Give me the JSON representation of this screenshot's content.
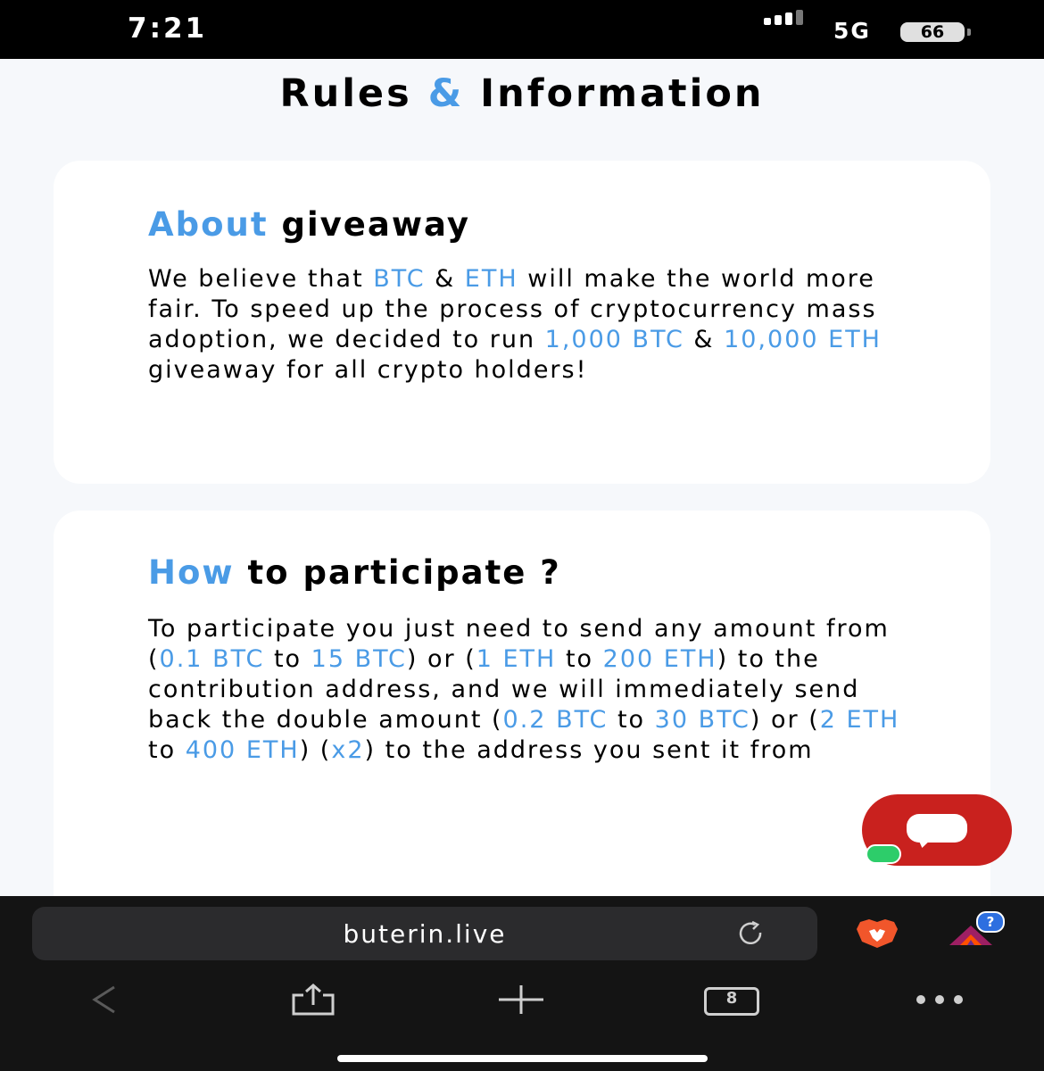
{
  "status_bar": {
    "time": "7:21",
    "network": "5G",
    "battery": "66"
  },
  "page": {
    "title_part1": "Rules",
    "title_amp": "&",
    "title_part2": "Information"
  },
  "about_card": {
    "title_accent": "About",
    "title_rest": "giveaway",
    "body": [
      {
        "t": "We believe that ",
        "hl": false
      },
      {
        "t": "BTC",
        "hl": true
      },
      {
        "t": " & ",
        "hl": false
      },
      {
        "t": "ETH",
        "hl": true
      },
      {
        "t": " will make the world more fair. To speed up the process of cryptocurrency mass adoption, we decided to run ",
        "hl": false
      },
      {
        "t": "1,000 BTC",
        "hl": true
      },
      {
        "t": " & ",
        "hl": false
      },
      {
        "t": "10,000 ETH",
        "hl": true
      },
      {
        "t": " giveaway for all crypto holders!",
        "hl": false
      }
    ]
  },
  "how_card": {
    "title_accent": "How",
    "title_rest": "to participate ?",
    "body": [
      {
        "t": "To participate you just need to send any amount from (",
        "hl": false
      },
      {
        "t": "0.1 BTC",
        "hl": true
      },
      {
        "t": " to ",
        "hl": false
      },
      {
        "t": "15 BTC",
        "hl": true
      },
      {
        "t": ") or (",
        "hl": false
      },
      {
        "t": "1 ETH",
        "hl": true
      },
      {
        "t": " to ",
        "hl": false
      },
      {
        "t": "200 ETH",
        "hl": true
      },
      {
        "t": ") to the contribution address, and we will immediately send back the double amount (",
        "hl": false
      },
      {
        "t": "0.2 BTC",
        "hl": true
      },
      {
        "t": " to ",
        "hl": false
      },
      {
        "t": "30 BTC",
        "hl": true
      },
      {
        "t": ") or (",
        "hl": false
      },
      {
        "t": "2 ETH",
        "hl": true
      },
      {
        "t": " to ",
        "hl": false
      },
      {
        "t": "400 ETH",
        "hl": true
      },
      {
        "t": ") (",
        "hl": false
      },
      {
        "t": "x2",
        "hl": true
      },
      {
        "t": ") to the address you sent it from",
        "hl": false
      }
    ]
  },
  "browser": {
    "url": "buterin.live",
    "tab_count": "8",
    "help_badge": "?"
  },
  "colors": {
    "accent": "#4a9be6",
    "chat": "#c9211e",
    "online": "#2dcd6a"
  },
  "icons": [
    "signal-icon",
    "reload-icon",
    "brave-shield-icon",
    "bat-rewards-icon",
    "back-icon",
    "share-icon",
    "new-tab-icon",
    "tabs-icon",
    "more-icon",
    "chat-icon"
  ]
}
